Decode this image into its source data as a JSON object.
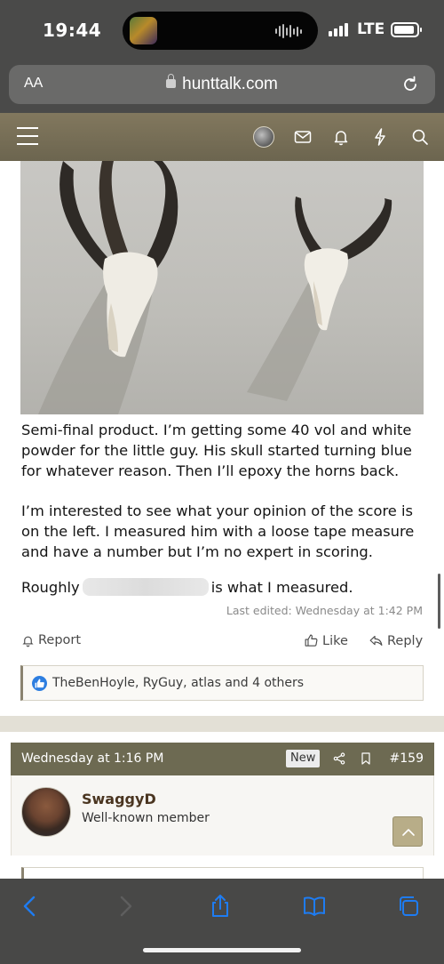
{
  "status_bar": {
    "time": "19:44",
    "network": "LTE"
  },
  "browser": {
    "aa_label": "AA",
    "url": "hunttalk.com"
  },
  "post": {
    "paragraphs": [
      "Semi-final product. I’m getting some 40 vol and white powder for the little guy. His skull started turning blue for whatever reason. Then I’ll epoxy the horns back.",
      "I’m interested to see what your opinion of the score is on the left. I measured him with a loose tape measure and have a number but I’m no expert in scoring."
    ],
    "roughly_prefix": "Roughly",
    "roughly_suffix": "is what I measured.",
    "last_edited": "Last edited: Wednesday at 1:42 PM",
    "report_label": "Report",
    "like_label": "Like",
    "reply_label": "Reply",
    "reactions_text": "TheBenHoyle, RyGuy, atlas and 4 others"
  },
  "next_post": {
    "date": "Wednesday at 1:16 PM",
    "badge": "New",
    "number": "#159",
    "username": "SwaggyD",
    "user_title": "Well-known member"
  },
  "colors": {
    "nav_bar": "#6c654f",
    "post_header": "#6d6a52",
    "ios_blue": "#1e7cf2"
  },
  "icons": [
    "hamburger-icon",
    "mail-icon",
    "bell-icon",
    "lightning-icon",
    "search-icon",
    "share-icon",
    "bookmark-icon"
  ]
}
